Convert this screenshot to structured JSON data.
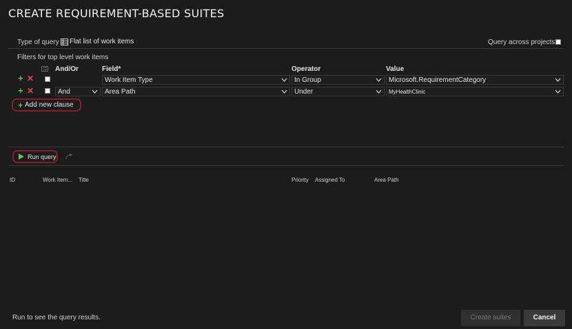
{
  "dialog": {
    "title": "CREATE REQUIREMENT-BASED SUITES"
  },
  "query": {
    "type_label": "Type of query",
    "type_value": "Flat list of work items",
    "across_projects_label": "Query across projects",
    "filters_label": "Filters for top level work items"
  },
  "grid": {
    "headers": {
      "andor": "And/Or",
      "field": "Field*",
      "operator": "Operator",
      "value": "Value"
    },
    "rows": [
      {
        "andor": "",
        "field": "Work Item Type",
        "operator": "In Group",
        "value": "Microsoft.RequirementCategory"
      },
      {
        "andor": "And",
        "field": "Area Path",
        "operator": "Under",
        "value": "MyHealthClinic"
      }
    ],
    "add_clause_label": "Add new clause"
  },
  "toolbar": {
    "run_query_label": "Run query"
  },
  "results": {
    "columns": [
      "ID",
      "Work Item...",
      "Title",
      "Priority",
      "Assigned To",
      "Area Path"
    ],
    "status": "Run to see the query results."
  },
  "footer": {
    "create_label": "Create suites",
    "cancel_label": "Cancel"
  },
  "colors": {
    "background": "#1c1c1c",
    "highlight_outline": "#8b1a2a",
    "add_green": "#6cc04a",
    "delete_red": "#e04848"
  }
}
